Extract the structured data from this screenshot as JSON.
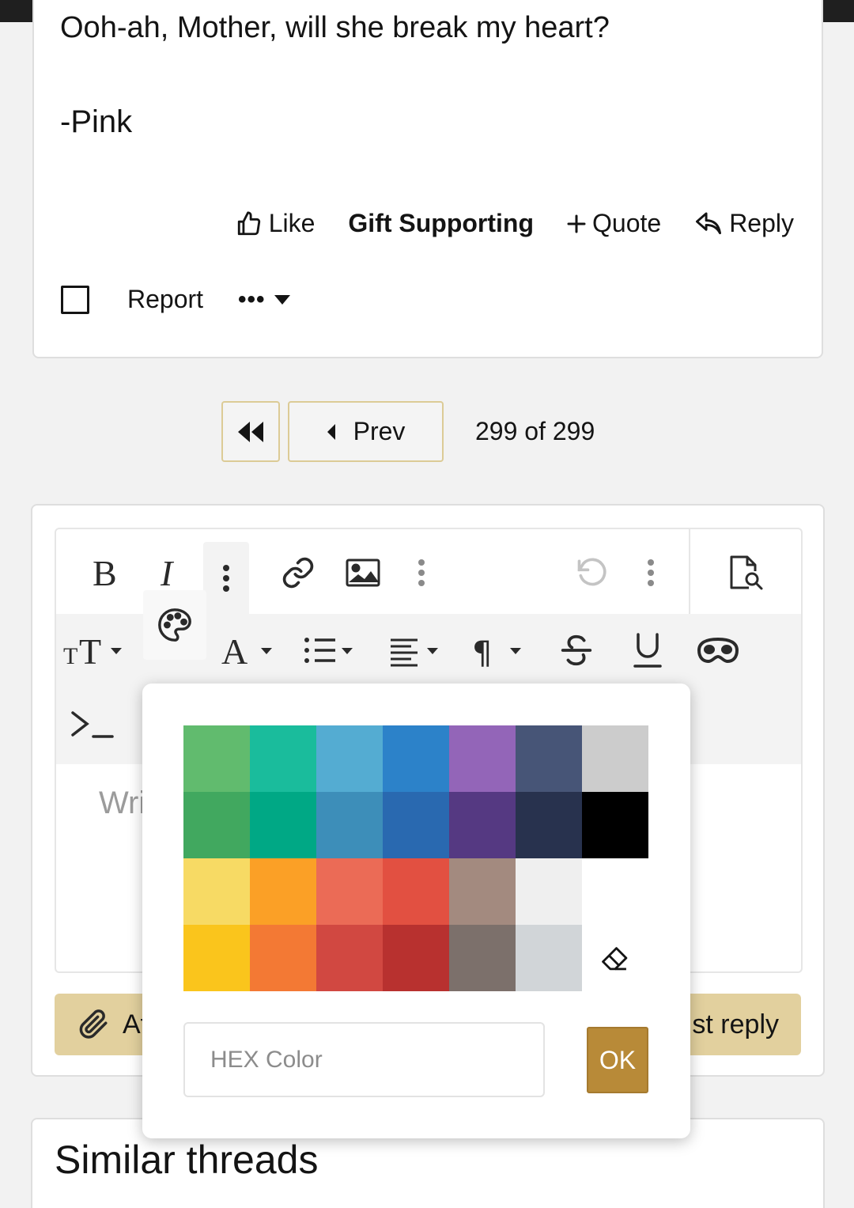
{
  "post": {
    "lyric_line": "Ooh-ah, Mother, will she break my heart?",
    "signature": "-Pink",
    "actions": {
      "like": "Like",
      "gift": "Gift Supporting",
      "quote": "Quote",
      "reply": "Reply"
    },
    "report": "Report",
    "more": "•••"
  },
  "pagination": {
    "prev": "Prev",
    "count": "299 of 299"
  },
  "editor": {
    "placeholder": "Wri",
    "attach_label": "At",
    "post_reply_label": "st reply"
  },
  "color_popup": {
    "swatches": [
      "#61bb6e",
      "#1abc9c",
      "#54acd2",
      "#2c82c9",
      "#9365b8",
      "#475577",
      "#cccccc",
      "#41a85f",
      "#00a885",
      "#3d8eb9",
      "#2969b0",
      "#553982",
      "#28324e",
      "#000000",
      "#f7da64",
      "#fba026",
      "#eb6b56",
      "#e25041",
      "#a38a7f",
      "#efefef",
      "#ffffff",
      "#fac51c",
      "#f37934",
      "#d14841",
      "#b8312f",
      "#7c706b",
      "#d1d5d8",
      "eraser"
    ],
    "hex_placeholder": "HEX Color",
    "ok_label": "OK"
  },
  "similar": {
    "title": "Similar threads"
  },
  "colors": {
    "accent": "#e2d09e",
    "ok_button": "#b88a38",
    "topbar": "#1f1f1f"
  }
}
